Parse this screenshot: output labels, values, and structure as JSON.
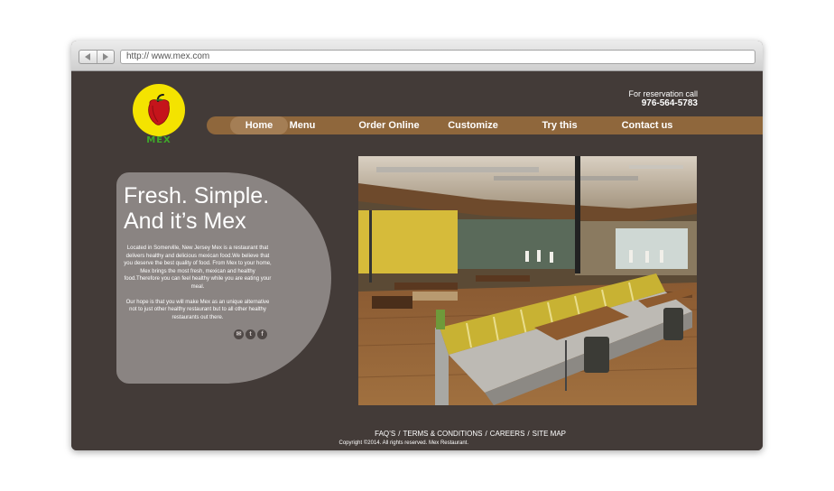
{
  "browser": {
    "url": "http://  www.mex.com"
  },
  "logo": {
    "text": "MEX",
    "icon": "red-pepper-icon"
  },
  "reservation": {
    "label": "For reservation call",
    "phone": "976-564-5783"
  },
  "nav": {
    "items": [
      {
        "label": "Home",
        "active": true
      },
      {
        "label": "Menu"
      },
      {
        "label": "Order Online"
      },
      {
        "label": "Customize"
      },
      {
        "label": "Try this"
      },
      {
        "label": "Contact us"
      }
    ]
  },
  "hero": {
    "title_line1": "Fresh. Simple.",
    "title_line2": "And it’s Mex",
    "paragraph1": "Located in Somerville, New Jersey Mex is a restaurant that delivers healthy and delicious mexican food.We believe that you deserve the best quality of food. From Mex to your home, Mex brings the most fresh, mexican and healthy food.Therefore you can feel healthy while  you are eating your meal.",
    "paragraph2": "Our hope is that you will make Mex as an unique alternative not to just other healthy restaurant but to all other healthy restaurants out there.",
    "social": [
      {
        "icon": "email-icon",
        "glyph": "✉"
      },
      {
        "icon": "twitter-icon",
        "glyph": "t"
      },
      {
        "icon": "facebook-icon",
        "glyph": "f"
      }
    ]
  },
  "photo": {
    "subject": "restaurant-interior-photo"
  },
  "footer": {
    "links": [
      "FAQ’S",
      "TERMS & CONDITIONS",
      "CAREERS",
      "SITE MAP"
    ],
    "separator": "/",
    "copyright": "Copyright ©2014. All rights reserved. Mex Restaurant."
  },
  "colors": {
    "page_bg": "#433b38",
    "nav_bg": "#8f673c",
    "logo_bg": "#f4e300",
    "logo_text": "#3fa82a",
    "pepper": "#c5141b"
  }
}
